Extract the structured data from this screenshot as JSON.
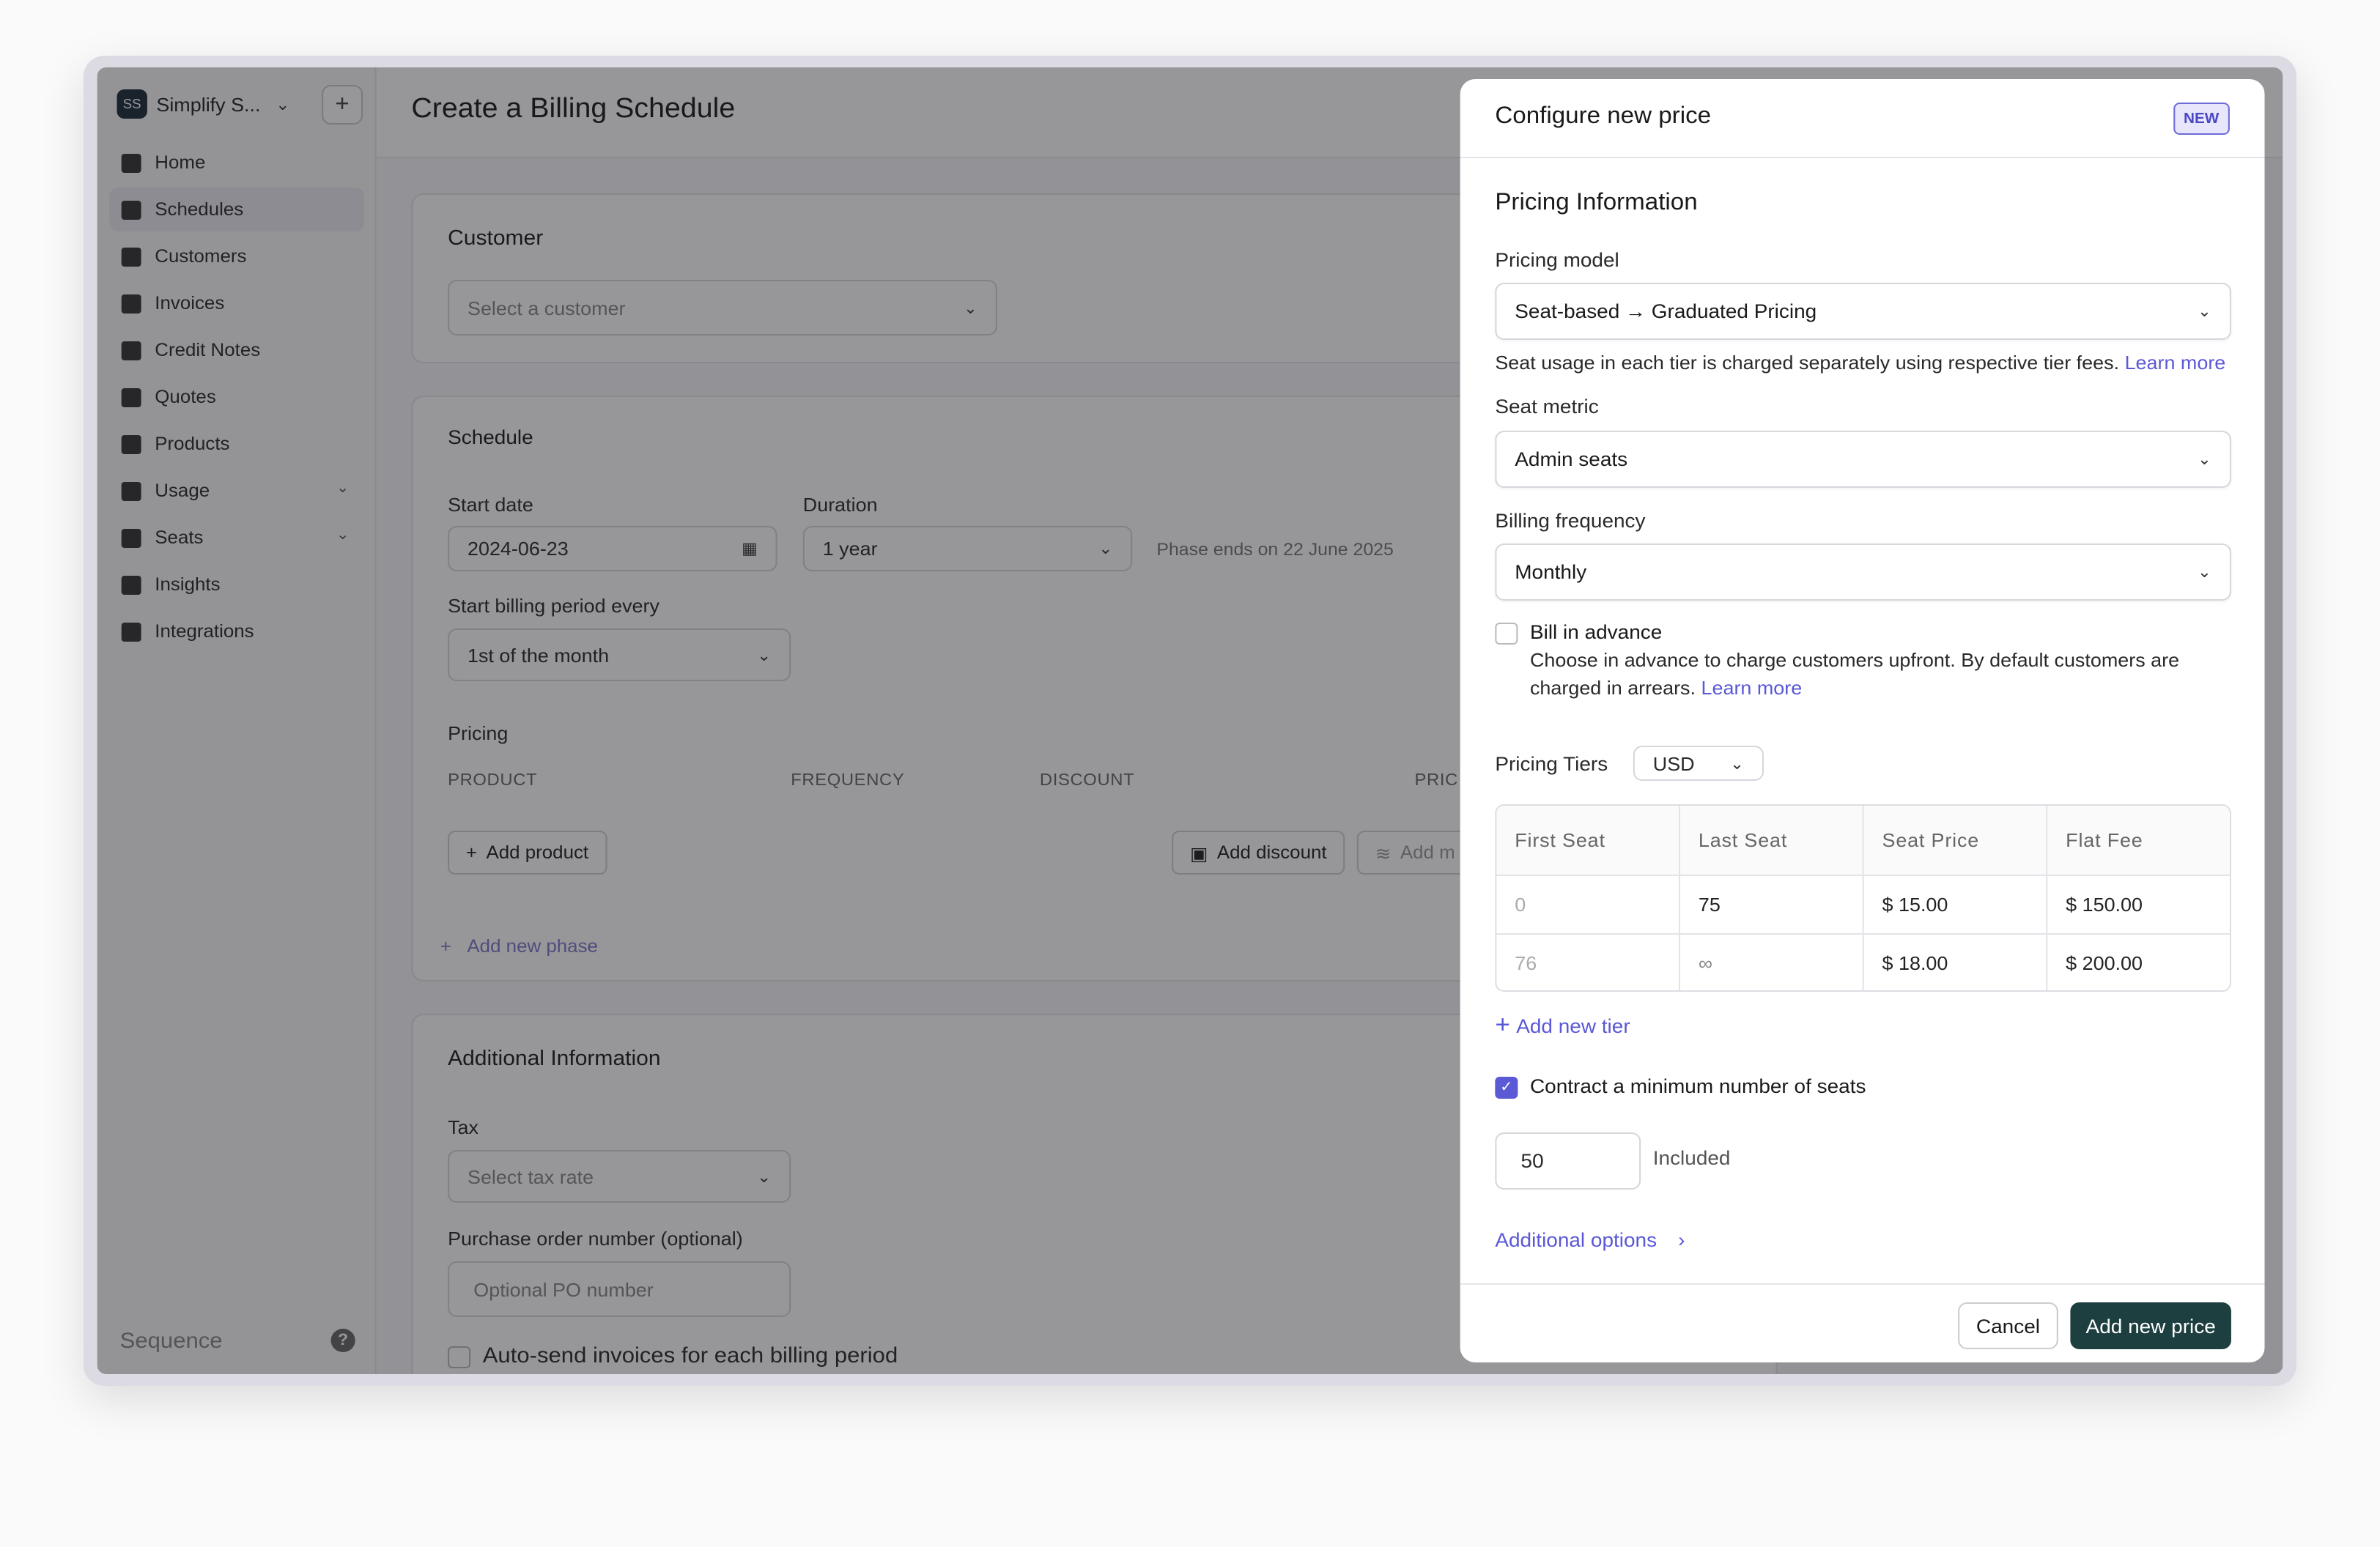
{
  "workspace": {
    "initials": "SS",
    "name": "Simplify S..."
  },
  "sidebar": {
    "items": [
      {
        "label": "Home"
      },
      {
        "label": "Schedules"
      },
      {
        "label": "Customers"
      },
      {
        "label": "Invoices"
      },
      {
        "label": "Credit Notes"
      },
      {
        "label": "Quotes"
      },
      {
        "label": "Products"
      },
      {
        "label": "Usage"
      },
      {
        "label": "Seats"
      },
      {
        "label": "Insights"
      },
      {
        "label": "Integrations"
      }
    ],
    "brand": "Sequence",
    "help": "?"
  },
  "main": {
    "title": "Create a Billing Schedule",
    "customer": {
      "title": "Customer",
      "placeholder": "Select a customer"
    },
    "schedule": {
      "title": "Schedule",
      "start_date_label": "Start date",
      "start_date": "2024-06-23",
      "duration_label": "Duration",
      "duration": "1 year",
      "phase_ends": "Phase ends on 22 June 2025",
      "billing_period_label": "Start billing period every",
      "billing_period": "1st of the month",
      "pricing_label": "Pricing",
      "columns": [
        "PRODUCT",
        "FREQUENCY",
        "DISCOUNT",
        "PRIC"
      ],
      "add_product": "Add product",
      "add_discount": "Add discount",
      "add_m": "Add m",
      "add_phase": "Add new phase"
    },
    "additional": {
      "title": "Additional Information",
      "tax_label": "Tax",
      "tax_placeholder": "Select tax rate",
      "po_label": "Purchase order number (optional)",
      "po_placeholder": "Optional PO number",
      "auto_send": "Auto-send invoices for each billing period"
    }
  },
  "panel": {
    "title": "Configure new price",
    "badge": "NEW",
    "section_title": "Pricing Information",
    "pricing_model_label": "Pricing model",
    "pricing_model": "Seat-based → Graduated Pricing",
    "pricing_model_help": "Seat usage in each tier is charged separately using respective tier fees.",
    "learn_more": "Learn more",
    "seat_metric_label": "Seat metric",
    "seat_metric": "Admin seats",
    "billing_frequency_label": "Billing frequency",
    "billing_frequency": "Monthly",
    "bill_in_advance_label": "Bill in advance",
    "bill_in_advance_help": "Choose in advance to charge customers upfront. By default customers are charged in arrears.",
    "pricing_tiers_label": "Pricing Tiers",
    "currency": "USD",
    "tier_columns": [
      "First Seat",
      "Last Seat",
      "Seat Price",
      "Flat Fee"
    ],
    "tiers": [
      {
        "first": "0",
        "last": "75",
        "price": "$  15.00",
        "fee": "$  150.00"
      },
      {
        "first": "76",
        "last": "∞",
        "price": "$  18.00",
        "fee": "$  200.00"
      }
    ],
    "add_tier": "Add new tier",
    "minimum_label": "Contract a minimum number of seats",
    "minimum_value": "50",
    "included": "Included",
    "additional_options": "Additional options",
    "cancel": "Cancel",
    "submit": "Add new price"
  }
}
